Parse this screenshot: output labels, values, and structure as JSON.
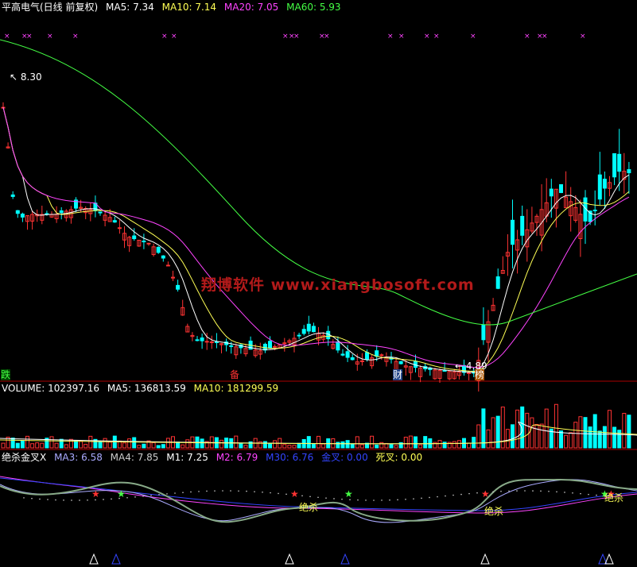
{
  "main_panel": {
    "stock_name": "平高电气(日线 前复权)",
    "indicators": [
      {
        "label": "MA5: 7.34",
        "color": "#ffffff"
      },
      {
        "label": "MA10: 7.14",
        "color": "#ffff55"
      },
      {
        "label": "MA20: 7.05",
        "color": "#ff44ff"
      },
      {
        "label": "MA60: 5.93",
        "color": "#44ff44"
      }
    ],
    "high_label": "8.30",
    "low_label": "4.89",
    "tags": [
      {
        "text": "跌",
        "color": "#44ff44",
        "bg": "#004400"
      },
      {
        "text": "备",
        "color": "#ff3333",
        "bg": "#000000"
      },
      {
        "text": "财",
        "color": "#ffffff",
        "bg": "#224488"
      },
      {
        "text": "榜",
        "color": "#ffffff",
        "bg": "#aa5500"
      }
    ],
    "watermark": "翔博软件 www.xiangbosoft.com"
  },
  "volume_panel": {
    "indicators": [
      {
        "label": "VOLUME: 102397.16",
        "color": "#ffffff"
      },
      {
        "label": "MA5: 136813.59",
        "color": "#ffffff"
      },
      {
        "label": "MA10: 181299.59",
        "color": "#ffff55"
      }
    ]
  },
  "indicator_panel": {
    "indicators": [
      {
        "label": "绝杀金叉X",
        "color": "#ffffff"
      },
      {
        "label": "MA3: 6.58",
        "color": "#aaaaff"
      },
      {
        "label": "MA4: 7.85",
        "color": "#cccccc"
      },
      {
        "label": "M1: 7.25",
        "color": "#ffffff"
      },
      {
        "label": "M2: 6.79",
        "color": "#ff44ff"
      },
      {
        "label": "M30: 6.76",
        "color": "#3344ff"
      },
      {
        "label": "金叉: 0.00",
        "color": "#3344ff"
      },
      {
        "label": "死叉: 0.00",
        "color": "#ffff55"
      }
    ],
    "signal_labels": [
      "绝杀",
      "绝杀",
      "绝杀"
    ]
  },
  "colors": {
    "up": "#ff3333",
    "down": "#00ffff",
    "ma5": "#ffffff",
    "ma10": "#ffff55",
    "ma20": "#ff44ff",
    "ma60": "#44ff44",
    "divider": "#aa0000"
  }
}
